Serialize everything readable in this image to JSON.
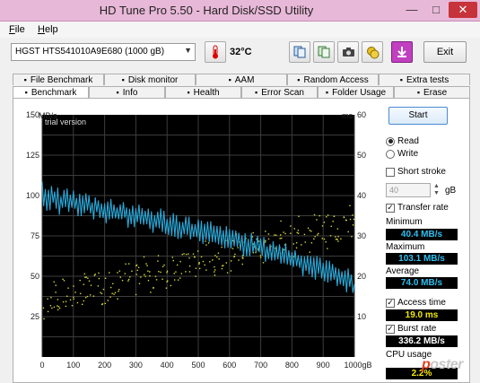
{
  "window": {
    "title": "HD Tune Pro 5.50 - Hard Disk/SSD Utility",
    "min": "—",
    "max": "□",
    "close": "✕"
  },
  "menu": [
    {
      "first": "F",
      "rest": "ile"
    },
    {
      "first": "H",
      "rest": "elp"
    }
  ],
  "toolbar": {
    "drive": "HGST HTS541010A9E680 (1000 gB)",
    "temperature": "32°C",
    "exit_label": "Exit"
  },
  "tabs_top": [
    {
      "label": "File Benchmark",
      "icon": "file-benchmark-icon"
    },
    {
      "label": "Disk monitor",
      "icon": "disk-monitor-icon"
    },
    {
      "label": "AAM",
      "icon": "speaker-icon"
    },
    {
      "label": "Random Access",
      "icon": "random-access-icon"
    },
    {
      "label": "Extra tests",
      "icon": "extra-tests-icon"
    }
  ],
  "tabs_bottom": [
    {
      "label": "Benchmark",
      "icon": "lightbulb-icon",
      "selected": true
    },
    {
      "label": "Info",
      "icon": "info-icon"
    },
    {
      "label": "Health",
      "icon": "health-cross-icon"
    },
    {
      "label": "Error Scan",
      "icon": "magnifier-icon"
    },
    {
      "label": "Folder Usage",
      "icon": "folder-icon"
    },
    {
      "label": "Erase",
      "icon": "erase-icon"
    }
  ],
  "side": {
    "start_label": "Start",
    "read_label": "Read",
    "write_label": "Write",
    "short_stroke_label": "Short stroke",
    "short_stroke_value": "40",
    "gb_label": "gB",
    "transfer_rate_label": "Transfer rate",
    "minimum_label": "Minimum",
    "minimum_value": "40.4 MB/s",
    "maximum_label": "Maximum",
    "maximum_value": "103.1 MB/s",
    "average_label": "Average",
    "average_value": "74.0 MB/s",
    "access_time_label": "Access time",
    "access_time_value": "19.0 ms",
    "burst_rate_label": "Burst rate",
    "burst_rate_value": "336.2 MB/s",
    "cpu_label": "CPU usage",
    "cpu_value": "2.2%"
  },
  "watermark": {
    "first": "p",
    "rest": "oster"
  },
  "chart_data": {
    "type": "line",
    "annotation": "trial version",
    "y_left_label": "MB/s",
    "y_right_label": "ms",
    "x_unit": "gB",
    "ylim_left": [
      0,
      150
    ],
    "ylim_right": [
      0,
      60
    ],
    "xlim": [
      0,
      1000
    ],
    "y_left_ticks": [
      25,
      50,
      75,
      100,
      125,
      150
    ],
    "y_right_ticks": [
      10,
      20,
      30,
      40,
      50,
      60
    ],
    "x_ticks": [
      0,
      100,
      200,
      300,
      400,
      500,
      600,
      700,
      800,
      900,
      1000
    ],
    "grid": true,
    "colors": {
      "background": "#000000",
      "grid": "#3c3c3c",
      "transfer": "#2aa8d8",
      "access": "#d8d83a",
      "text": "#dddddd"
    },
    "series": [
      {
        "metric": "transfer_rate",
        "x": [
          0,
          20,
          40,
          60,
          80,
          100,
          120,
          140,
          160,
          180,
          200,
          220,
          240,
          260,
          280,
          300,
          320,
          340,
          360,
          380,
          400,
          420,
          440,
          460,
          480,
          500,
          520,
          540,
          560,
          580,
          600,
          620,
          640,
          660,
          680,
          700,
          720,
          740,
          760,
          780,
          800,
          820,
          840,
          860,
          880,
          900,
          920,
          940,
          960,
          980,
          1000
        ],
        "y": [
          101,
          97,
          99,
          95,
          98,
          96,
          94,
          95,
          92,
          93,
          90,
          91,
          89,
          90,
          87,
          88,
          85,
          86,
          84,
          85,
          82,
          83,
          80,
          81,
          78,
          79,
          76,
          77,
          74,
          75,
          72,
          73,
          70,
          70,
          68,
          68,
          65,
          66,
          63,
          64,
          60,
          60,
          57,
          58,
          55,
          55,
          52,
          52,
          49,
          47,
          45
        ]
      },
      {
        "metric": "access_time",
        "x": [
          0,
          25,
          50,
          75,
          100,
          125,
          150,
          175,
          200,
          225,
          250,
          275,
          300,
          325,
          350,
          375,
          400,
          425,
          450,
          475,
          500,
          525,
          550,
          575,
          600,
          625,
          650,
          675,
          700,
          725,
          750,
          775,
          800,
          825,
          850,
          875,
          900,
          925,
          950,
          975,
          1000
        ],
        "y": [
          13,
          15,
          14,
          16,
          15,
          17,
          16,
          18,
          17,
          19,
          18,
          20,
          19,
          21,
          20,
          22,
          21,
          23,
          22,
          24,
          23,
          25,
          24,
          26,
          25,
          27,
          26,
          28,
          27,
          29,
          28,
          30,
          29,
          31,
          30,
          32,
          31,
          33,
          32,
          34,
          33
        ]
      }
    ]
  }
}
